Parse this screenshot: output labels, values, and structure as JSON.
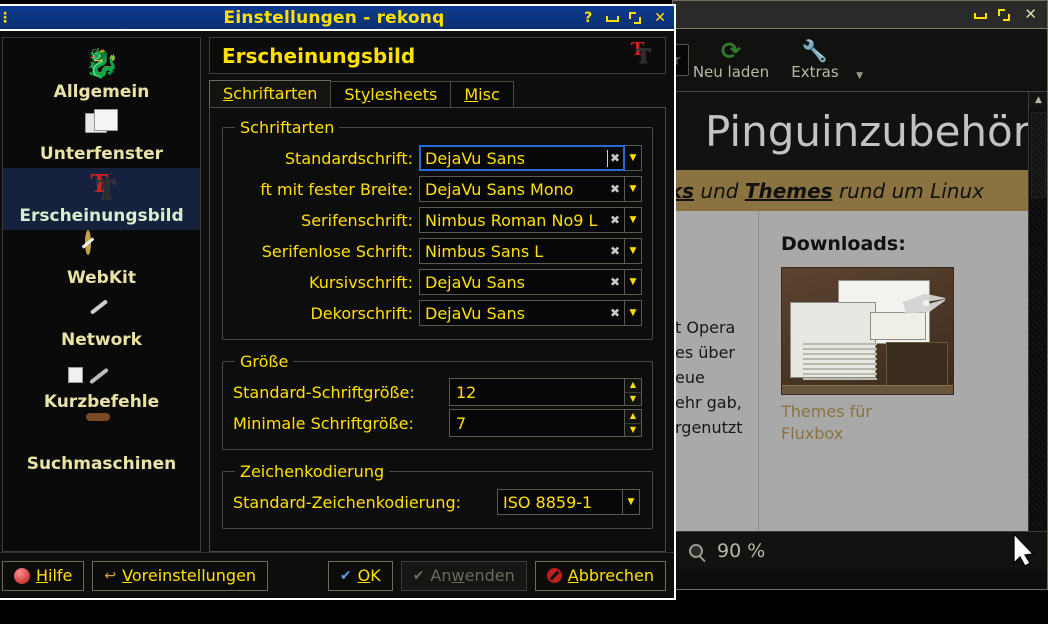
{
  "dialog": {
    "title": "Einstellungen - rekonq",
    "titlebar_buttons": {
      "help": "?",
      "minimize": "minimize-icon",
      "maximize": "maximize-icon",
      "close": "✕"
    },
    "sidebar": {
      "items": [
        {
          "label": "Allgemein",
          "icon": "konqueror-icon",
          "selected": false
        },
        {
          "label": "Unterfenster",
          "icon": "tabs-folder-icon",
          "selected": false
        },
        {
          "label": "Erscheinungsbild",
          "icon": "fonts-tt-icon",
          "selected": true
        },
        {
          "label": "WebKit",
          "icon": "compass-icon",
          "selected": false
        },
        {
          "label": "Network",
          "icon": "network-globe-icon",
          "selected": false
        },
        {
          "label": "Kurzbefehle",
          "icon": "wrench-icon",
          "selected": false
        },
        {
          "label": "Suchmaschinen",
          "icon": "search-globe-icon",
          "selected": false
        }
      ]
    },
    "panel": {
      "header_title": "Erscheinungsbild",
      "header_icon": "fonts-tt-icon",
      "tabs": [
        {
          "label": "Schriftarten",
          "accel": "S",
          "active": true
        },
        {
          "label": "Stylesheets",
          "accel": "y",
          "active": false
        },
        {
          "label": "Misc",
          "accel": "M",
          "active": false
        }
      ],
      "groups": {
        "fonts": {
          "legend": "Schriftarten",
          "rows": [
            {
              "label": "Standardschrift:",
              "value": "DejaVu Sans",
              "focused": true
            },
            {
              "label": "ft mit fester Breite:",
              "value": "DejaVu Sans Mono",
              "focused": false
            },
            {
              "label": "Serifenschrift:",
              "value": "Nimbus Roman No9 L",
              "focused": false
            },
            {
              "label": "Serifenlose Schrift:",
              "value": "Nimbus Sans L",
              "focused": false
            },
            {
              "label": "Kursivschrift:",
              "value": "DejaVu Sans",
              "focused": false
            },
            {
              "label": "Dekorschrift:",
              "value": "DejaVu Sans",
              "focused": false
            }
          ]
        },
        "size": {
          "legend": "Größe",
          "rows": [
            {
              "label": "Standard-Schriftgröße:",
              "value": "12"
            },
            {
              "label": "Minimale Schriftgröße:",
              "value": "7"
            }
          ]
        },
        "encoding": {
          "legend": "Zeichenkodierung",
          "label": "Standard-Zeichenkodierung:",
          "value": "ISO 8859-1"
        }
      }
    },
    "footer": {
      "help": "Hilfe",
      "help_accel": "H",
      "defaults": "Voreinstellungen",
      "defaults_accel": "V",
      "ok": "OK",
      "ok_accel": "O",
      "apply": "Anwenden",
      "apply_accel": "w",
      "apply_disabled": true,
      "cancel": "Abbrechen",
      "cancel_accel": "A"
    }
  },
  "browser": {
    "titlebar_buttons": {
      "minimize": "minimize-icon",
      "restore": "restore-icon",
      "close": "✕"
    },
    "urlbar": {
      "rss_icon": "rss-icon",
      "bookmark_icon": "star-icon"
    },
    "toolbar": [
      {
        "label": "Neu laden",
        "icon": "reload-icon"
      },
      {
        "label": "Extras",
        "icon": "wrench-icon",
        "has_menu": true
      }
    ],
    "page": {
      "title": "Pinguinzubehör",
      "banner_prefix": "cks",
      "banner_mid": " und ",
      "banner_bold": "Themes",
      "banner_suffix": " rund um Linux",
      "left_column_lines": [
        "t Opera",
        "es über",
        "eue",
        "ehr gab,",
        "rgenutzt"
      ],
      "downloads_heading": "Downloads:",
      "thumb_caption_line1": "Themes für",
      "thumb_caption_line2": "Fluxbox"
    },
    "status": {
      "zoom_icon": "magnifier-icon",
      "zoom": "90 %"
    }
  },
  "colors": {
    "accent_yellow": "#ffe000",
    "titlebar_blue": "#0d3b8d",
    "selection_blue": "#16213d",
    "page_band": "#8a7340",
    "focus_border": "#2a6ad6"
  }
}
